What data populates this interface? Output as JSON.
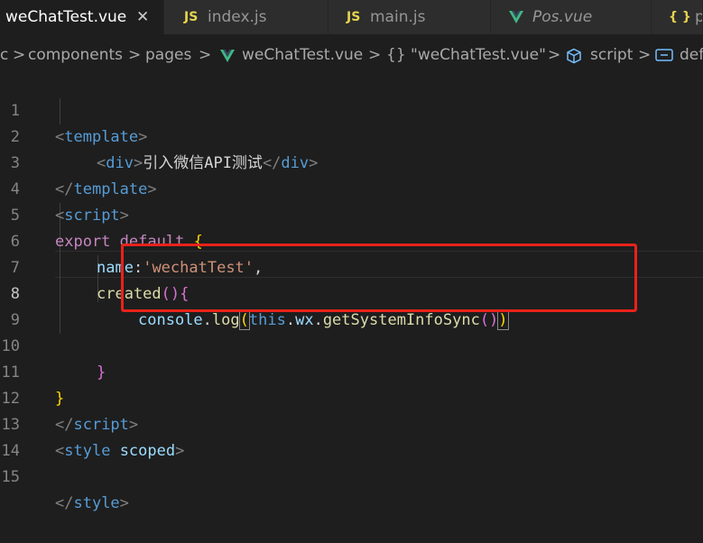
{
  "tabs": [
    {
      "label": "weChatTest.vue",
      "close": "✕",
      "icon": "vue-icon"
    },
    {
      "label": "index.js",
      "icon": "JS"
    },
    {
      "label": "main.js",
      "icon": "JS"
    },
    {
      "label": "Pos.vue",
      "icon": "vue-icon"
    },
    {
      "label": "p",
      "icon": "{ }"
    }
  ],
  "breadcrumb": {
    "items": [
      "c",
      "components",
      "pages",
      "weChatTest.vue",
      "\"weChatTest.vue\"",
      "script",
      "def"
    ],
    "separator": ">",
    "object_icon": "{}"
  },
  "editor": {
    "line_numbers": [
      "1",
      "2",
      "3",
      "4",
      "5",
      "6",
      "7",
      "8",
      "9",
      "10",
      "11",
      "12",
      "13",
      "14",
      "15"
    ],
    "current_line": 8,
    "tokens": {
      "template": "template",
      "div": "div",
      "div_text": "引入微信API测试",
      "script": "script",
      "export": "export",
      "default": "default",
      "name_key": "name",
      "name_val": "'wechatTest'",
      "created": "created",
      "console": "console",
      "log": "log",
      "this": "this",
      "wx": "wx",
      "getSystemInfoSync": "getSystemInfoSync",
      "style": "style",
      "scoped": "scoped"
    }
  },
  "colors": {
    "highlight_box": "#e8221b",
    "js_icon": "#e6d44f",
    "vue_icon": "#41b883"
  }
}
